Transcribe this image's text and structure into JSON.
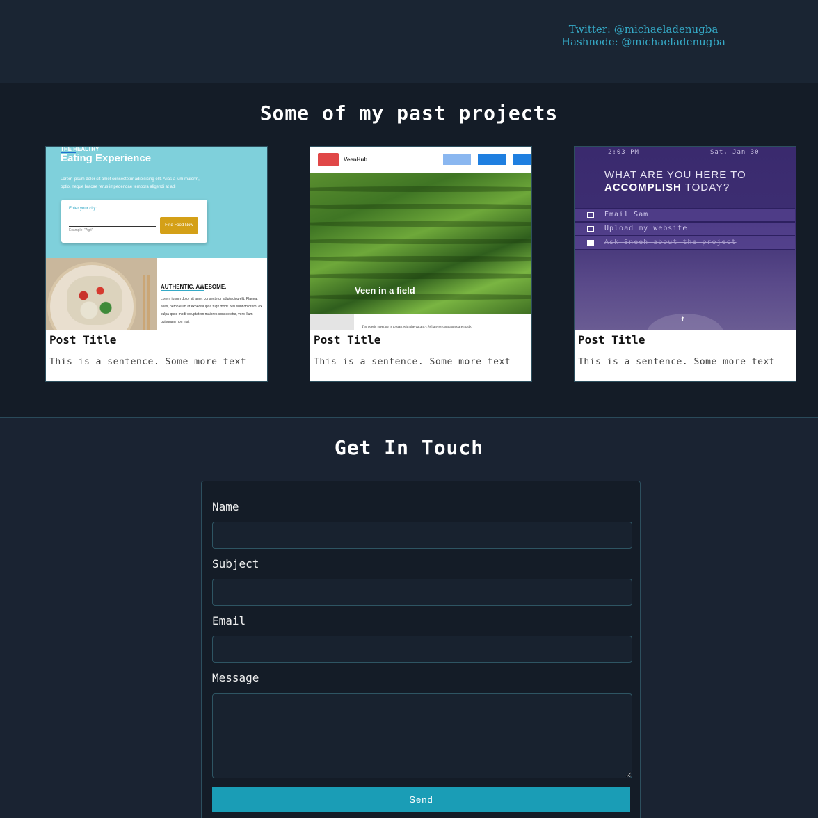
{
  "social": {
    "twitter": "Twitter: @michaeladenugba",
    "hashnode": "Hashnode: @michaeladenugba"
  },
  "projects": {
    "title": "Some of my past projects",
    "cards": [
      {
        "post_title": "Post Title",
        "post_text": "This is a sentence. Some more text",
        "preview": {
          "small_heading": "THE HEALTHY",
          "heading": "Eating Experience",
          "lorem": "Lorem ipsum dolor sit amet consectetur adipisicing elit. Alias a ium malorm, optio, neque bracae rerus impedendae tempora aligendi at adi",
          "city_label": "Enter your city:",
          "city_example": "Example: \"Agit\"",
          "button": "Find Food Now",
          "section_heading": "AUTHENTIC. AWESOME.",
          "section_text": "Lorem ipsum dolor sit amet consectetur adipisicing elit. Placeat alias, nemo eum at expedita ipsa fugit modi! Nisi sunt dolorem, ex culpa quos modi voluptatem maiores consectetur, vero illum quisquam non nisi."
        }
      },
      {
        "post_title": "Post Title",
        "post_text": "This is a sentence. Some more text",
        "preview": {
          "brand": "VeenHub",
          "caption": "Veen in a field",
          "footer_text": "The poetic greeting is to start with the vacancy. Whatever companies are made."
        }
      },
      {
        "post_title": "Post Title",
        "post_text": "This is a sentence. Some more text",
        "preview": {
          "time": "2:03 PM",
          "date": "Sat, Jan 30",
          "question_line1": "WHAT ARE YOU HERE TO",
          "question_bold": "ACCOMPLISH",
          "question_rest": " TODAY?",
          "tasks": [
            "Email Sam",
            "Upload my website",
            "Ask Sneeh about the project"
          ]
        }
      }
    ]
  },
  "contact": {
    "title": "Get In Touch",
    "name_label": "Name",
    "subject_label": "Subject",
    "email_label": "Email",
    "message_label": "Message",
    "send_label": "Send"
  },
  "colors": {
    "accent": "#1a9db6",
    "link": "#35a9c6",
    "background": "#1a2332"
  }
}
